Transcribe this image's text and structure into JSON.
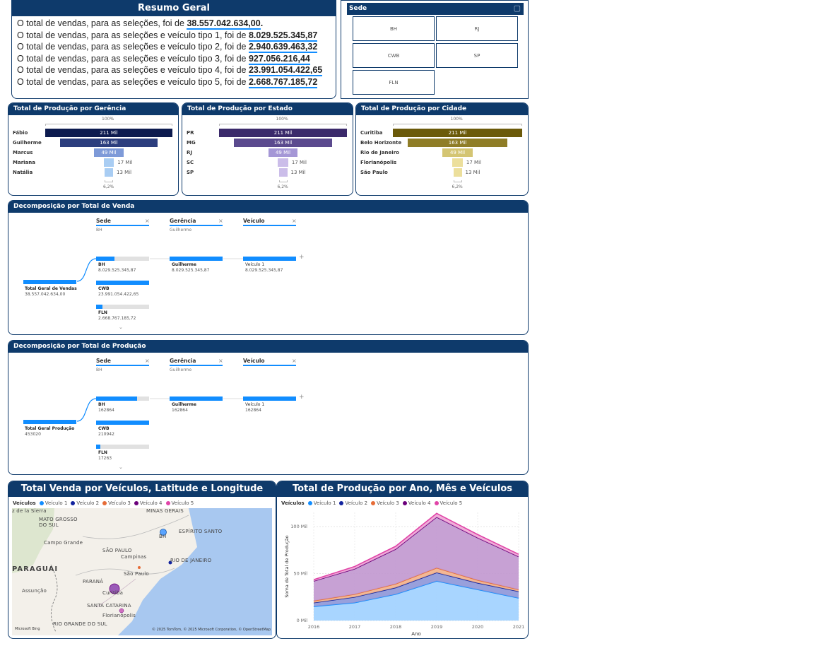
{
  "summary": {
    "title": "Resumo Geral",
    "lines": [
      {
        "text": "O total de vendas, para as seleções, foi de ",
        "value": "38.557.042.634,00",
        "suffix": "."
      },
      {
        "text": "O total de vendas, para as seleções e veículo tipo 1, foi de ",
        "value": "8.029.525.345,87",
        "suffix": ""
      },
      {
        "text": "O total de vendas, para as seleções e veículo tipo 2, foi de ",
        "value": "2.940.639.463,32",
        "suffix": ""
      },
      {
        "text": "O total de vendas, para as seleções e veículo tipo 3, foi de ",
        "value": "927.056.216,44",
        "suffix": ""
      },
      {
        "text": "O total de vendas, para as seleções e veículo tipo 4, foi de ",
        "value": "23.991.054.422,65",
        "suffix": ""
      },
      {
        "text": "O total de vendas, para as seleções e veículo tipo 5, foi de ",
        "value": "2.668.767.185,72",
        "suffix": ""
      }
    ]
  },
  "sede_slicer": {
    "title": "Sede",
    "options": [
      "BH",
      "RJ",
      "CWB",
      "SP",
      "FLN"
    ]
  },
  "funnels": [
    {
      "title": "Total de Produção por Gerência",
      "top_pct": "100%",
      "bottom_pct": "6,2%",
      "colors": [
        "#0d1b4f",
        "#2c3e7e",
        "#7e9ad8",
        "#a9cdf3",
        "#a9cdf3"
      ],
      "rows": [
        {
          "label": "Fábio",
          "value": "211 Mil",
          "ratio": 1.0
        },
        {
          "label": "Guilherme",
          "value": "163 Mil",
          "ratio": 0.772
        },
        {
          "label": "Marcus",
          "value": "49 Mil",
          "ratio": 0.232
        },
        {
          "label": "Mariana",
          "value": "17 Mil",
          "ratio": 0.081
        },
        {
          "label": "Natália",
          "value": "13 Mil",
          "ratio": 0.062
        }
      ]
    },
    {
      "title": "Total de Produção por Estado",
      "top_pct": "100%",
      "bottom_pct": "6,2%",
      "colors": [
        "#3b2a6b",
        "#5b4a8e",
        "#a597d6",
        "#cbbde9",
        "#cbbde9"
      ],
      "rows": [
        {
          "label": "PR",
          "value": "211 Mil",
          "ratio": 1.0
        },
        {
          "label": "MG",
          "value": "163 Mil",
          "ratio": 0.772
        },
        {
          "label": "RJ",
          "value": "49 Mil",
          "ratio": 0.232
        },
        {
          "label": "SC",
          "value": "17 Mil",
          "ratio": 0.081
        },
        {
          "label": "SP",
          "value": "13 Mil",
          "ratio": 0.062
        }
      ]
    },
    {
      "title": "Total de Produção por Cidade",
      "top_pct": "100%",
      "bottom_pct": "6,2%",
      "colors": [
        "#6b5a0a",
        "#8f7d27",
        "#d4c573",
        "#ecdf9c",
        "#ecdf9c"
      ],
      "rows": [
        {
          "label": "Curitiba",
          "value": "211 Mil",
          "ratio": 1.0
        },
        {
          "label": "Belo Horizonte",
          "value": "163 Mil",
          "ratio": 0.772
        },
        {
          "label": "Rio de Janeiro",
          "value": "49 Mil",
          "ratio": 0.232
        },
        {
          "label": "Florianópolis",
          "value": "17 Mil",
          "ratio": 0.081
        },
        {
          "label": "São Paulo",
          "value": "13 Mil",
          "ratio": 0.062
        }
      ]
    }
  ],
  "decomp_venda": {
    "title": "Decomposição por Total de Venda",
    "columns": [
      {
        "title": "Sede",
        "sub": "BH"
      },
      {
        "title": "Gerência",
        "sub": "Guilherme"
      },
      {
        "title": "Veículo",
        "sub": ""
      }
    ],
    "root": {
      "label": "Total Geral de Vendas",
      "value": "38.557.042.634,00"
    },
    "sede_nodes": [
      {
        "label": "BH",
        "value": "8.029.525.345,87",
        "fill": 0.35
      },
      {
        "label": "CWB",
        "value": "23.991.054.422,65",
        "fill": 1.0
      },
      {
        "label": "FLN",
        "value": "2.668.767.185,72",
        "fill": 0.12
      }
    ],
    "ger_node": {
      "label": "Guilherme",
      "value": "8.029.525.345,87"
    },
    "vei_node": {
      "label": "Veículo 1",
      "value": "8.029.525.345,87"
    }
  },
  "decomp_prod": {
    "title": "Decomposição por Total de Produção",
    "columns": [
      {
        "title": "Sede",
        "sub": "BH"
      },
      {
        "title": "Gerência",
        "sub": "Guilherme"
      },
      {
        "title": "Veículo",
        "sub": ""
      }
    ],
    "root": {
      "label": "Total Geral Produção",
      "value": "453020"
    },
    "sede_nodes": [
      {
        "label": "BH",
        "value": "162864",
        "fill": 0.776
      },
      {
        "label": "CWB",
        "value": "210942",
        "fill": 1.0
      },
      {
        "label": "FLN",
        "value": "17263",
        "fill": 0.082
      }
    ],
    "ger_node": {
      "label": "Guilherme",
      "value": "162864"
    },
    "vei_node": {
      "label": "Veículo 1",
      "value": "162864"
    }
  },
  "map": {
    "title": "Total Venda por Veículos, Latitude e Longitude",
    "legend_title": "Veículos",
    "series": [
      {
        "name": "Veículo 1",
        "color": "#118dff"
      },
      {
        "name": "Veículo 2",
        "color": "#12239e"
      },
      {
        "name": "Veículo 3",
        "color": "#e66c37"
      },
      {
        "name": "Veículo 4",
        "color": "#6b007b"
      },
      {
        "name": "Veículo 5",
        "color": "#e044a7"
      }
    ],
    "place_labels": [
      "z de la Sierra",
      "MATO GROSSO DO SUL",
      "MINAS GERAIS",
      "ESPÍRITO SANTO",
      "BH",
      "Campo Grande",
      "SÃO PAULO",
      "Campinas",
      "RIO DE JANEIRO",
      "PARAGUAI",
      "São Paulo",
      "PARANÁ",
      "Assunção",
      "Curitiba",
      "SANTA CATARINA",
      "Florianópolis",
      "RIO GRANDE DO SUL"
    ],
    "attribution": "© 2025 TomTom, © 2025 Microsoft Corporation, © OpenStreetMap",
    "brand": "Microsoft Bing"
  },
  "area_chart": {
    "title": "Total de Produção por Ano, Mês e Veículos",
    "legend_title": "Veículos"
  },
  "chart_data": {
    "type": "area",
    "title": "Total de Produção por Ano, Mês e Veículos",
    "xlabel": "Ano",
    "ylabel": "Soma de Total de Produção",
    "x": [
      2016,
      2017,
      2018,
      2019,
      2020,
      2021
    ],
    "y_ticks": [
      "0 Mil",
      "50 Mil",
      "100 Mil"
    ],
    "ylim": [
      0,
      115000
    ],
    "stacked": true,
    "series": [
      {
        "name": "Veículo 1",
        "color": "#118dff",
        "values": [
          15000,
          19000,
          28000,
          42000,
          33000,
          24000
        ]
      },
      {
        "name": "Veículo 2",
        "color": "#12239e",
        "values": [
          4000,
          6000,
          7000,
          9000,
          7000,
          7000
        ]
      },
      {
        "name": "Veículo 3",
        "color": "#e66c37",
        "values": [
          2000,
          3000,
          4000,
          5000,
          3000,
          2000
        ]
      },
      {
        "name": "Veículo 4",
        "color": "#6b007b",
        "values": [
          21000,
          27000,
          37000,
          54000,
          45000,
          35000
        ]
      },
      {
        "name": "Veículo 5",
        "color": "#e044a7",
        "values": [
          1500,
          2500,
          3000,
          4000,
          3500,
          2500
        ]
      }
    ]
  }
}
